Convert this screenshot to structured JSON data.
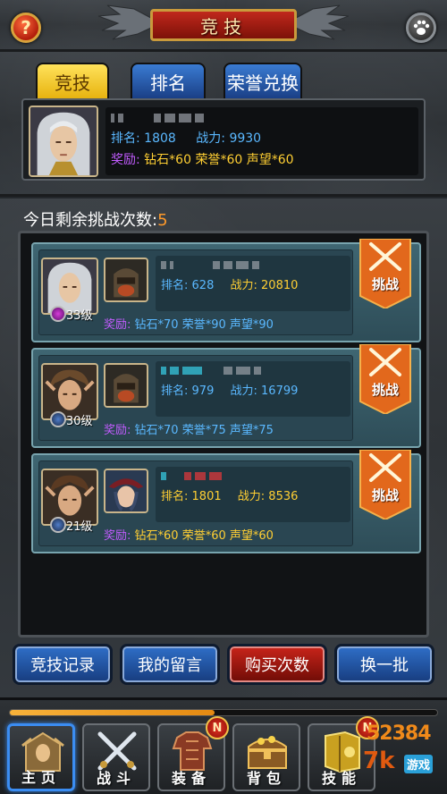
{
  "header": {
    "title": "竞技",
    "help_label": "?"
  },
  "tabs": [
    {
      "label": "竞技",
      "active": true
    },
    {
      "label": "排名",
      "active": false
    },
    {
      "label": "荣誉兑换",
      "active": false
    }
  ],
  "player": {
    "rank_label": "排名:",
    "rank": "1808",
    "power_label": "战力:",
    "power": "9930",
    "reward_label": "奖励:",
    "reward_diamond": "钻石*60",
    "reward_honor": "荣誉*60",
    "reward_prestige": "声望*60"
  },
  "remaining": {
    "label": "今日剩余挑战次数:",
    "count": "5"
  },
  "opponents": [
    {
      "level": "33级",
      "rank_label": "排名:",
      "rank": "628",
      "power_label": "战力:",
      "power": "20810",
      "reward_label": "奖励:",
      "reward_diamond": "钻石*70",
      "reward_honor": "荣誉*90",
      "reward_prestige": "声望*90",
      "challenge_label": "挑战"
    },
    {
      "level": "30级",
      "rank_label": "排名:",
      "rank": "979",
      "power_label": "战力:",
      "power": "16799",
      "reward_label": "奖励:",
      "reward_diamond": "钻石*70",
      "reward_honor": "荣誉*75",
      "reward_prestige": "声望*75",
      "challenge_label": "挑战"
    },
    {
      "level": "21级",
      "rank_label": "排名:",
      "rank": "1801",
      "power_label": "战力:",
      "power": "8536",
      "reward_label": "奖励:",
      "reward_diamond": "钻石*60",
      "reward_honor": "荣誉*60",
      "reward_prestige": "声望*60",
      "challenge_label": "挑战"
    }
  ],
  "actions": {
    "record": "竞技记录",
    "message": "我的留言",
    "buy": "购买次数",
    "refresh": "换一批"
  },
  "nav": [
    {
      "label": "主页",
      "icon": "home-icon",
      "active": true
    },
    {
      "label": "战斗",
      "icon": "swords-icon",
      "active": false
    },
    {
      "label": "装备",
      "icon": "armor-icon",
      "active": false,
      "badge": "N"
    },
    {
      "label": "背包",
      "icon": "chest-icon",
      "active": false
    },
    {
      "label": "技能",
      "icon": "skillbook-icon",
      "active": false,
      "badge": "N"
    }
  ],
  "xp_progress": 0.48,
  "watermark": {
    "top": "52384",
    "mid": "7k",
    "side": "游戏"
  },
  "colors": {
    "accent_orange": "#ff9a2a",
    "rank_blue": "#5ab8ff",
    "reward_purple": "#c25cff",
    "value_yellow": "#ffcf33"
  }
}
